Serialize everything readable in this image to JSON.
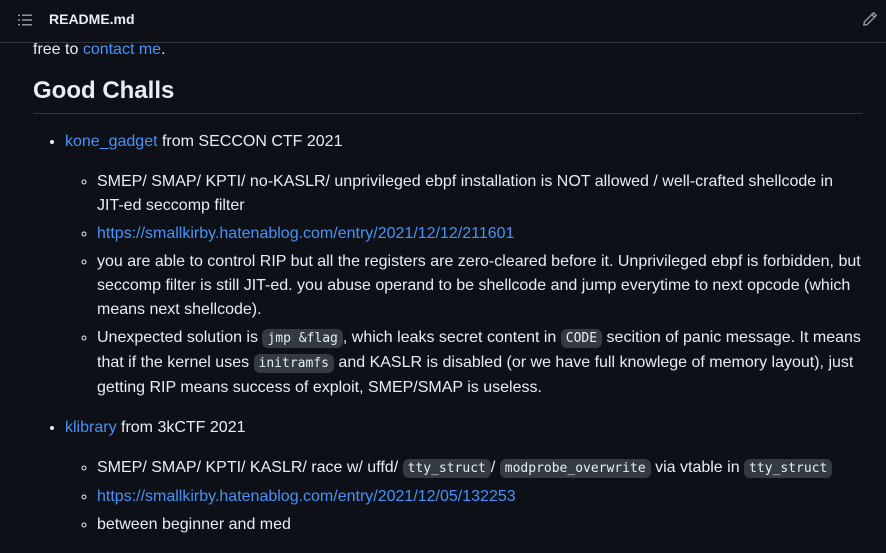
{
  "header": {
    "filename": "README.md",
    "toc_icon": "list-unordered-icon",
    "edit_icon": "pencil-icon"
  },
  "intro": {
    "prefix": "free to ",
    "link": "contact me",
    "suffix": "."
  },
  "section": {
    "heading": "Good Challs"
  },
  "challs": [
    {
      "name": "kone_gadget",
      "from": " from SECCON CTF 2021",
      "notes": {
        "n1": "SMEP/ SMAP/ KPTI/ no-KASLR/ unprivileged ebpf installation is NOT allowed / well-crafted shellcode in JIT-ed seccomp filter",
        "url": "https://smallkirby.hatenablog.com/entry/2021/12/12/211601",
        "n3": "you are able to control RIP but all the registers are zero-cleared before it. Unprivileged ebpf is forbidden, but seccomp filter is still JIT-ed. you abuse operand to be shellcode and jump everytime to next opcode (which means next shellcode).",
        "n4_a": "Unexpected solution is ",
        "n4_code1": "jmp &flag",
        "n4_b": ", which leaks secret content in ",
        "n4_code2": "CODE",
        "n4_c": " secition of panic message. It means that if the kernel uses ",
        "n4_code3": "initramfs",
        "n4_d": " and KASLR is disabled (or we have full knowlege of memory layout), just getting RIP means success of exploit, SMEP/SMAP is useless."
      }
    },
    {
      "name": "klibrary",
      "from": " from 3kCTF 2021",
      "notes": {
        "n1_a": "SMEP/ SMAP/ KPTI/ KASLR/ race w/ uffd/ ",
        "n1_code1": "tty_struct",
        "n1_b": "/ ",
        "n1_code2": "modprobe_overwrite",
        "n1_c": " via vtable in ",
        "n1_code3": "tty_struct",
        "url": "https://smallkirby.hatenablog.com/entry/2021/12/05/132253",
        "n3": "between beginner and med"
      }
    }
  ]
}
